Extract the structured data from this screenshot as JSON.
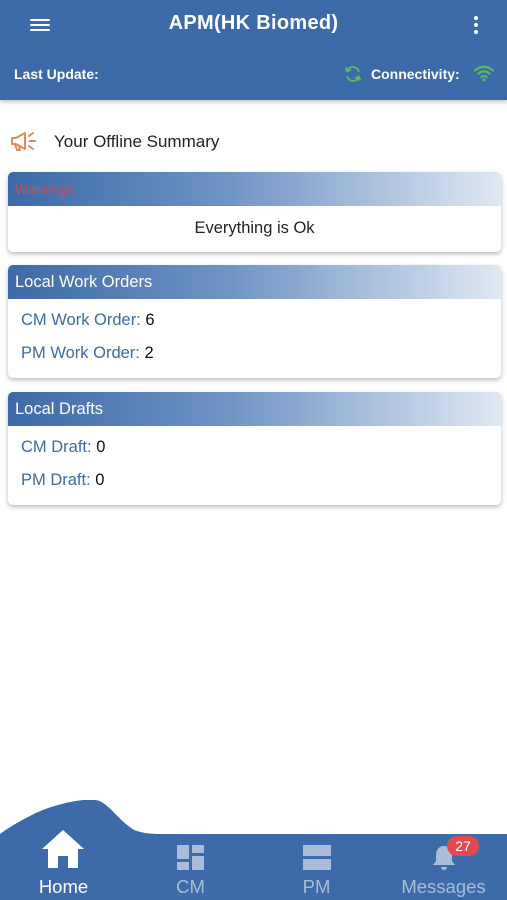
{
  "header": {
    "title": "APM(HK Biomed)",
    "last_update_label": "Last Update:",
    "connectivity_label": "Connectivity:"
  },
  "summary": {
    "label": "Your Offline Summary"
  },
  "warnings": {
    "title": "Warnings",
    "message": "Everything is Ok"
  },
  "local_work_orders": {
    "title": "Local Work Orders",
    "rows": [
      {
        "label": "CM Work Order:",
        "value": "6"
      },
      {
        "label": "PM Work Order:",
        "value": "2"
      }
    ]
  },
  "local_drafts": {
    "title": "Local Drafts",
    "rows": [
      {
        "label": "CM Draft:",
        "value": "0"
      },
      {
        "label": "PM Draft:",
        "value": "0"
      }
    ]
  },
  "tabs": [
    {
      "label": "Home",
      "icon": "home-icon",
      "active": true
    },
    {
      "label": "CM",
      "icon": "dashboard-icon",
      "active": false
    },
    {
      "label": "PM",
      "icon": "list-icon",
      "active": false
    },
    {
      "label": "Messages",
      "icon": "bell-icon",
      "active": false,
      "badge": "27"
    }
  ],
  "colors": {
    "primary": "#3d6aa8",
    "accent_orange": "#e0895a",
    "sync_green": "#5cb85c",
    "warning_red": "#d24a50",
    "badge_red": "#e44950"
  }
}
